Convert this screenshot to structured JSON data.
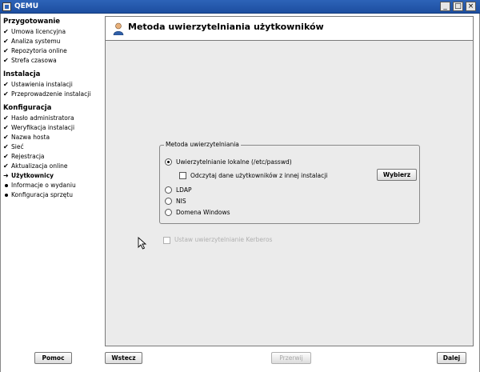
{
  "window": {
    "title": "QEMU",
    "minimize": "_",
    "maximize": "□",
    "close": "×"
  },
  "sidebar": {
    "sections": [
      {
        "title": "Przygotowanie",
        "steps": [
          {
            "label": "Umowa licencyjna",
            "state": "done"
          },
          {
            "label": "Analiza systemu",
            "state": "done"
          },
          {
            "label": "Repozytoria online",
            "state": "done"
          },
          {
            "label": "Strefa czasowa",
            "state": "done"
          }
        ]
      },
      {
        "title": "Instalacja",
        "steps": [
          {
            "label": "Ustawienia instalacji",
            "state": "done"
          },
          {
            "label": "Przeprowadzenie instalacji",
            "state": "done"
          }
        ]
      },
      {
        "title": "Konfiguracja",
        "steps": [
          {
            "label": "Hasło administratora",
            "state": "done"
          },
          {
            "label": "Weryfikacja instalacji",
            "state": "done"
          },
          {
            "label": "Nazwa hosta",
            "state": "done"
          },
          {
            "label": "Sieć",
            "state": "done"
          },
          {
            "label": "Rejestracja",
            "state": "done"
          },
          {
            "label": "Aktualizacja online",
            "state": "done"
          },
          {
            "label": "Użytkownicy",
            "state": "current"
          },
          {
            "label": "Informacje o wydaniu",
            "state": "pending"
          },
          {
            "label": "Konfiguracja sprzętu",
            "state": "pending"
          }
        ]
      }
    ]
  },
  "main": {
    "title": "Metoda uwierzytelniania użytkowników",
    "group": {
      "title": "Metoda uwierzytelniania",
      "local": "Uwierzytelnianie lokalne (/etc/passwd)",
      "read_other": "Odczytaj dane użytkowników z innej instalacji",
      "choose_button": "Wybierz",
      "ldap": "LDAP",
      "nis": "NIS",
      "windows": "Domena Windows"
    },
    "kerberos": "Ustaw uwierzytelnianie Kerberos"
  },
  "bottom": {
    "help": "Pomoc",
    "back": "Wstecz",
    "abort": "Przerwij",
    "next": "Dalej"
  },
  "colors": {
    "titlebar": "#2d63b8",
    "panel": "#ebebeb",
    "disabled": "#b0b0b0"
  },
  "icons": {
    "done": "check-icon",
    "current": "arrow-right-icon",
    "pending": "bullet-icon"
  }
}
